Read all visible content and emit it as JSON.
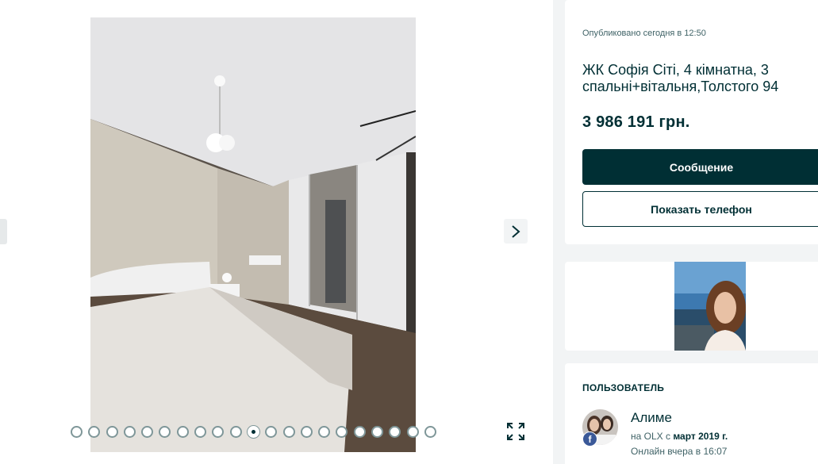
{
  "gallery": {
    "photo_alt": "bedroom",
    "dot_count": 21,
    "active_index": 10,
    "next_icon": "chevron-right-icon",
    "expand_icon": "expand-icon"
  },
  "ad": {
    "posted": "Опубликовано сегодня в 12:50",
    "title": "ЖК Софія Сіті, 4 кімнатна, 3 спальні+вітальня,Толстого 94",
    "price": "3 986 191 грн.",
    "message_button": "Сообщение",
    "phone_button": "Показать телефон"
  },
  "user": {
    "heading": "ПОЛЬЗОВАТЕЛЬ",
    "name": "Алиме",
    "since_prefix": "на OLX с ",
    "since_date": "март 2019 г.",
    "online": "Онлайн вчера в 16:07",
    "badge": "f"
  },
  "colors": {
    "primary": "#002f34",
    "background": "#f2f4f5",
    "facebook": "#3b5998"
  }
}
